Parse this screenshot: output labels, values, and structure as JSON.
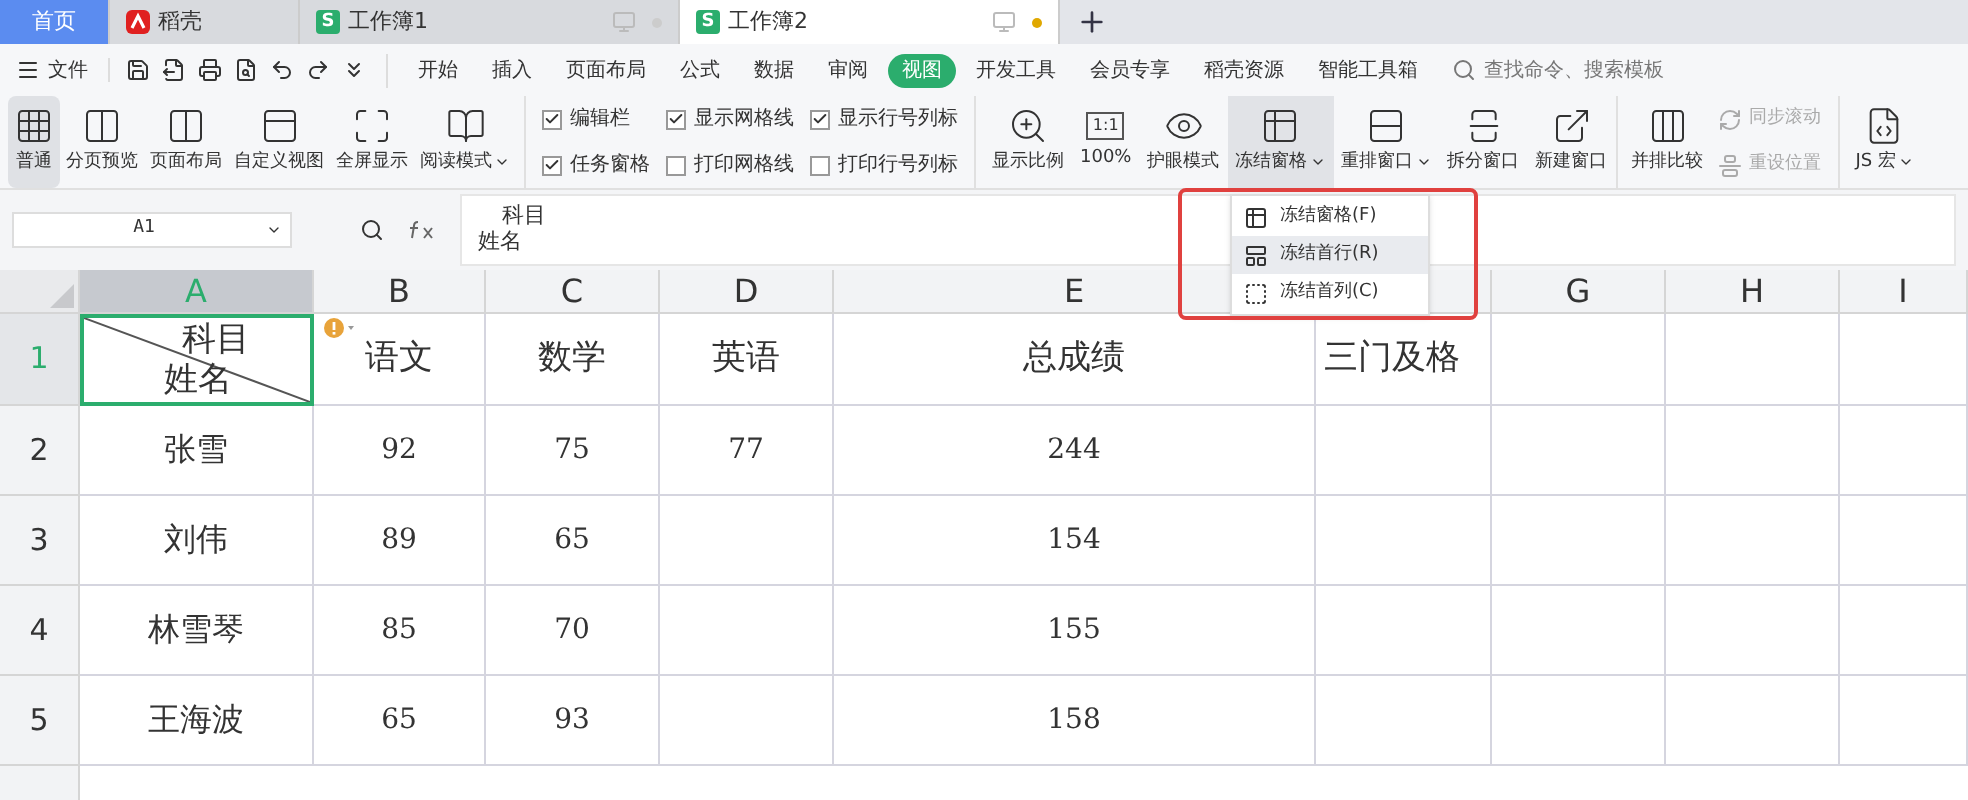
{
  "tabs": [
    {
      "label": "首页",
      "kind": "home",
      "selected": false
    },
    {
      "label": "稻壳",
      "kind": "docer",
      "selected": false
    },
    {
      "label": "工作簿1",
      "kind": "sheet",
      "logo_text": "S",
      "selected": false
    },
    {
      "label": "工作簿2",
      "kind": "sheet",
      "logo_text": "S",
      "selected": true
    }
  ],
  "menu": {
    "file": "文件",
    "tabs": [
      {
        "label": "开始",
        "selected": false
      },
      {
        "label": "插入",
        "selected": false
      },
      {
        "label": "页面布局",
        "selected": false
      },
      {
        "label": "公式",
        "selected": false
      },
      {
        "label": "数据",
        "selected": false
      },
      {
        "label": "审阅",
        "selected": false
      },
      {
        "label": "视图",
        "selected": true
      },
      {
        "label": "开发工具",
        "selected": false
      },
      {
        "label": "会员专享",
        "selected": false
      },
      {
        "label": "稻壳资源",
        "selected": false
      },
      {
        "label": "智能工具箱",
        "selected": false
      }
    ],
    "search": {
      "placeholder": "查找命令、搜索模板"
    }
  },
  "ribbon": {
    "views": [
      {
        "label": "普通",
        "selected": true,
        "dropdown": false
      },
      {
        "label": "分页预览",
        "selected": false,
        "dropdown": false
      },
      {
        "label": "页面布局",
        "selected": false,
        "dropdown": false
      },
      {
        "label": "自定义视图",
        "selected": false,
        "dropdown": false
      },
      {
        "label": "全屏显示",
        "selected": false,
        "dropdown": false
      },
      {
        "label": "阅读模式",
        "selected": false,
        "dropdown": true
      }
    ],
    "checkboxes": [
      {
        "label": "编辑栏",
        "checked": true
      },
      {
        "label": "任务窗格",
        "checked": true
      },
      {
        "label": "显示网格线",
        "checked": true
      },
      {
        "label": "打印网格线",
        "checked": false
      },
      {
        "label": "显示行号列标",
        "checked": true
      },
      {
        "label": "打印行号列标",
        "checked": false
      }
    ],
    "tools": [
      {
        "label": "显示比例",
        "selected": false,
        "dropdown": false
      },
      {
        "label": "100%",
        "icon_text": "1:1",
        "selected": false,
        "dropdown": false
      },
      {
        "label": "护眼模式",
        "selected": false,
        "dropdown": false
      },
      {
        "label": "冻结窗格",
        "selected": true,
        "dropdown": true
      },
      {
        "label": "重排窗口",
        "selected": false,
        "dropdown": true
      },
      {
        "label": "拆分窗口",
        "selected": false,
        "dropdown": false
      },
      {
        "label": "新建窗口",
        "selected": false,
        "dropdown": false
      }
    ],
    "compare": {
      "label": "并排比较"
    },
    "small": [
      {
        "label": "同步滚动",
        "disabled": true
      },
      {
        "label": "重设位置",
        "disabled": true
      }
    ],
    "macro": {
      "label": "JS 宏",
      "dropdown": true
    }
  },
  "name_box": "A1",
  "formula": {
    "lines": [
      "科目",
      "姓名"
    ]
  },
  "freeze_menu": [
    {
      "label": "冻结窗格(F)",
      "selected": false
    },
    {
      "label": "冻结首行(R)",
      "selected": true
    },
    {
      "label": "冻结首列(C)",
      "selected": false
    }
  ],
  "columns": [
    {
      "label": "A",
      "selected": true
    },
    {
      "label": "B",
      "selected": false
    },
    {
      "label": "C",
      "selected": false
    },
    {
      "label": "D",
      "selected": false
    },
    {
      "label": "E",
      "selected": false
    },
    {
      "label": "G",
      "selected": false
    },
    {
      "label": "H",
      "selected": false
    },
    {
      "label": "I",
      "selected": false
    }
  ],
  "header_row": {
    "number": "1",
    "diag_top": "科目",
    "diag_bottom": "姓名",
    "cells": [
      "语文",
      "数学",
      "英语",
      "总成绩",
      "三门及格"
    ]
  },
  "rows": [
    {
      "number": "2",
      "cells": [
        "张雪",
        "92",
        "75",
        "77",
        "244"
      ]
    },
    {
      "number": "3",
      "cells": [
        "刘伟",
        "89",
        "65",
        "",
        "154"
      ]
    },
    {
      "number": "4",
      "cells": [
        "林雪琴",
        "85",
        "70",
        "",
        "155"
      ]
    },
    {
      "number": "5",
      "cells": [
        "王海波",
        "65",
        "93",
        "",
        "158"
      ]
    }
  ]
}
